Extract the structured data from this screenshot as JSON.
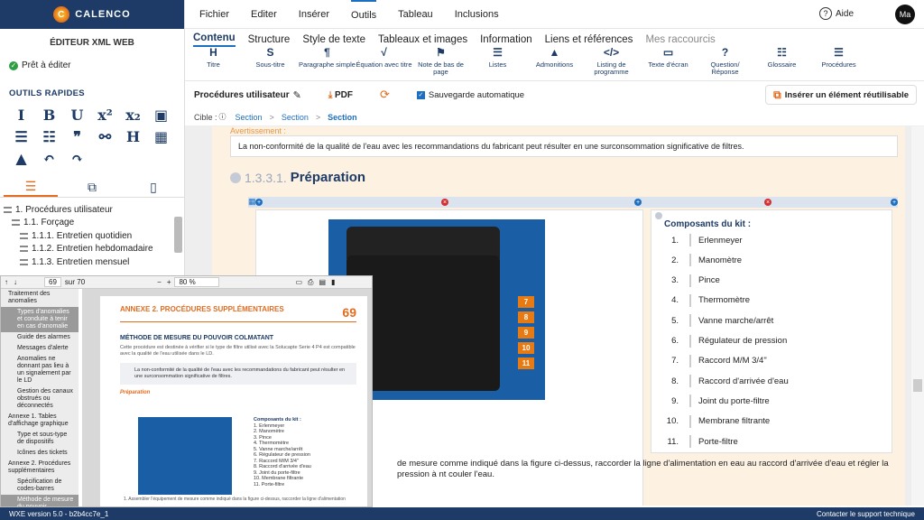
{
  "brand": {
    "name": "CALENCO",
    "mark": "C"
  },
  "left": {
    "editor_title": "ÉDITEUR XML WEB",
    "status": "Prêt à éditer",
    "quick_title": "OUTILS RAPIDES",
    "quick_tools": [
      {
        "icon": "italic-icon",
        "glyph": "I"
      },
      {
        "icon": "bold-icon",
        "glyph": "B"
      },
      {
        "icon": "underline-icon",
        "glyph": "U"
      },
      {
        "icon": "superscript-icon",
        "glyph": "x²"
      },
      {
        "icon": "subscript-icon",
        "glyph": "x₂"
      },
      {
        "icon": "image-icon",
        "glyph": "▣"
      },
      {
        "icon": "bullet-list-icon",
        "glyph": "☰"
      },
      {
        "icon": "numbered-list-icon",
        "glyph": "☷"
      },
      {
        "icon": "quote-icon",
        "glyph": "❞"
      },
      {
        "icon": "link-icon",
        "glyph": "⚯"
      },
      {
        "icon": "heading-icon",
        "glyph": "H"
      },
      {
        "icon": "table-icon",
        "glyph": "▦"
      },
      {
        "icon": "warning-icon",
        "glyph": "▲"
      },
      {
        "icon": "undo-icon",
        "glyph": "↶"
      },
      {
        "icon": "redo-icon",
        "glyph": "↷"
      }
    ],
    "tabs": [
      {
        "icon": "list-icon",
        "glyph": "☰"
      },
      {
        "icon": "comments-icon",
        "glyph": "⧉"
      },
      {
        "icon": "bookmark-icon",
        "glyph": "▯"
      }
    ],
    "tree": [
      {
        "label": "1. Procédures utilisateur",
        "indent": 0
      },
      {
        "label": "1.1. Forçage",
        "indent": 1
      },
      {
        "label": "1.1.1. Entretien quotidien",
        "indent": 2
      },
      {
        "label": "1.1.2. Entretien hebdomadaire",
        "indent": 2
      },
      {
        "label": "1.1.3. Entretien mensuel",
        "indent": 2
      }
    ]
  },
  "topnav": {
    "menus": [
      "Fichier",
      "Editer",
      "Insérer",
      "Outils",
      "Tableau",
      "Inclusions"
    ],
    "active_menu": "Outils",
    "help": "Aide",
    "avatar": "Ma"
  },
  "subtabs": [
    "Contenu",
    "Structure",
    "Style de texte",
    "Tableaux et images",
    "Information",
    "Liens et références",
    "Mes raccourcis"
  ],
  "toolbar": [
    {
      "icon": "heading-icon",
      "glyph": "H",
      "label": "Titre"
    },
    {
      "icon": "subtitle-icon",
      "glyph": "S",
      "label": "Sous-titre"
    },
    {
      "icon": "paragraph-icon",
      "glyph": "¶",
      "label": "Paragraphe simple"
    },
    {
      "icon": "equation-icon",
      "glyph": "√",
      "label": "Équation avec titre"
    },
    {
      "icon": "footnote-icon",
      "glyph": "⚑",
      "label": "Note de bas de page"
    },
    {
      "icon": "list-icon",
      "glyph": "☰",
      "label": "Listes"
    },
    {
      "icon": "warning-icon",
      "glyph": "▲",
      "label": "Admonitions"
    },
    {
      "icon": "code-icon",
      "glyph": "</>",
      "label": "Listing de programme"
    },
    {
      "icon": "screen-icon",
      "glyph": "▭",
      "label": "Texte d'écran"
    },
    {
      "icon": "question-icon",
      "glyph": "?",
      "label": "Question/ Réponse"
    },
    {
      "icon": "glossary-icon",
      "glyph": "☷",
      "label": "Glossaire"
    },
    {
      "icon": "procedure-icon",
      "glyph": "☰",
      "label": "Procédures"
    }
  ],
  "actionbar": {
    "proc_label": "Procédures utilisateur",
    "pdf": "PDF",
    "autosave": "Sauvegarde automatique",
    "insert": "Insérer un élément réutilisable"
  },
  "breadcrumb": {
    "cible": "Cible :",
    "items": [
      "Section",
      "Section",
      "Section"
    ]
  },
  "doc": {
    "warn_title": "Avertissement :",
    "warn_text": "La non-conformité de la qualité de l'eau avec les recommandations du fabricant peut résulter en une surconsommation significative de filtres.",
    "section_num": "1.3.3.1.",
    "section_title": "Préparation",
    "callouts": [
      "7",
      "8",
      "9",
      "10",
      "11"
    ],
    "comp_title": "Composants du kit :",
    "components": [
      "Erlenmeyer",
      "Manomètre",
      "Pince",
      "Thermomètre",
      "Vanne marche/arrêt",
      "Régulateur de pression",
      "Raccord M/M 3/4\"",
      "Raccord d'arrivée d'eau",
      "Joint du porte-filtre",
      "Membrane filtrante",
      "Porte-filtre"
    ],
    "para": "de mesure comme indiqué dans la figure ci-dessus, raccorder la ligne d'alimentation en eau au raccord d'arrivée d'eau et régler la pression à nt couler l'eau."
  },
  "pdf": {
    "page": "69",
    "total": "sur 70",
    "zoom": "80 %",
    "sidebar": [
      {
        "label": "Traitement des anomalies",
        "top": true
      },
      {
        "label": "Types d'anomalies et conduite à tenir en cas d'anomalie",
        "sel": true
      },
      {
        "label": "Guide des alarmes"
      },
      {
        "label": "Messages d'alerte"
      },
      {
        "label": "Anomalies ne donnant pas lieu à un signalement par le LD"
      },
      {
        "label": "Gestion des canaux obstrués ou déconnectés"
      },
      {
        "label": "Annexe 1. Tables d'affichage graphique",
        "top": true
      },
      {
        "label": "Type et sous-type de dispositifs"
      },
      {
        "label": "Icônes des tickets"
      },
      {
        "label": "Annexe 2. Procédures supplémentaires",
        "top": true
      },
      {
        "label": "Spécification de codes-barres"
      },
      {
        "label": "Méthode de mesure du pouvoir colmatant",
        "sel": true
      }
    ],
    "head": "ANNEXE 2. PROCÉDURES SUPPLÉMENTAIRES",
    "head_page": "69",
    "title": "MÉTHODE DE MESURE DU POUVOIR COLMATANT",
    "text": "Cette procédure est destinée à vérifier si le type de filtre utilisé avec la Solucapte Serie 4 P4 est compatible avec la qualité de l'eau utilisée dans le LD.",
    "warn": "La non-conformité de la qualité de l'eau avec les recommandations du fabricant peut résulter en une surconsommation significative de filtres.",
    "prep": "Préparation",
    "list_title": "Composants du kit :",
    "list": [
      "1. Erlenmeyer",
      "2. Manomètre",
      "3. Pince",
      "4. Thermomètre",
      "5. Vanne marche/arrêt",
      "6. Régulateur de pression",
      "7. Raccord M/M 3/4\"",
      "8. Raccord d'arrivée d'eau",
      "9. Joint du porte-filtre",
      "10. Membrane filtrante",
      "11. Porte-filtre"
    ],
    "foot": "1. Assembler l'équipement de mesure comme indiqué dans la figure ci-dessus, raccorder la ligne d'alimentation"
  },
  "status": {
    "version": "WXE version 5.0 - b2b4cc7e_1",
    "support": "Contacter le support technique"
  },
  "colors": {
    "navy": "#1d3b66",
    "orange": "#e36c1e",
    "blue": "#1d6fc1",
    "doc_bg": "#fdf1e2"
  }
}
